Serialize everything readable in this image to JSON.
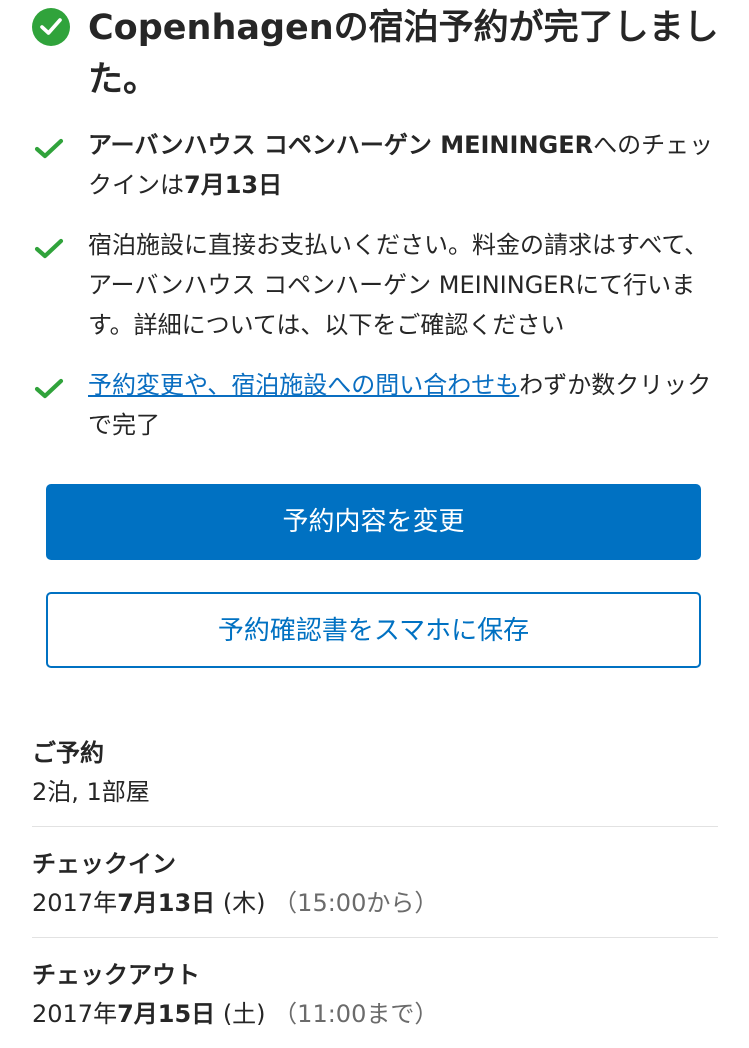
{
  "header": {
    "title": "Copenhagenの宿泊予約が完了しました。",
    "icon": "check-circle-icon",
    "icon_color": "#30a33b"
  },
  "bullets": [
    {
      "bold": "アーバンハウス コペンハーゲン MEININGER",
      "text_mid": "へのチェックインは",
      "bold_end": "7月13日"
    },
    {
      "text": "宿泊施設に直接お支払いください。料金の請求はすべて、アーバンハウス コペンハーゲン MEININGERにて行います。詳細については、以下をご確認ください"
    },
    {
      "link": "予約変更や、宿泊施設への問い合わせも",
      "text": "わずか数クリックで完了"
    }
  ],
  "buttons": {
    "modify": "予約内容を変更",
    "save": "予約確認書をスマホに保存"
  },
  "details": {
    "booking": {
      "label": "ご予約",
      "value": "2泊, 1部屋"
    },
    "checkin": {
      "label": "チェックイン",
      "year": "2017年",
      "date": "7月13日",
      "weekday": " (木) ",
      "time": "（15:00から）"
    },
    "checkout": {
      "label": "チェックアウト",
      "year": "2017年",
      "date": "7月15日",
      "weekday": " (土) ",
      "time": "（11:00まで）"
    }
  },
  "colors": {
    "accent": "#0071c2",
    "link": "#0a6ec1",
    "success": "#30a33b"
  }
}
